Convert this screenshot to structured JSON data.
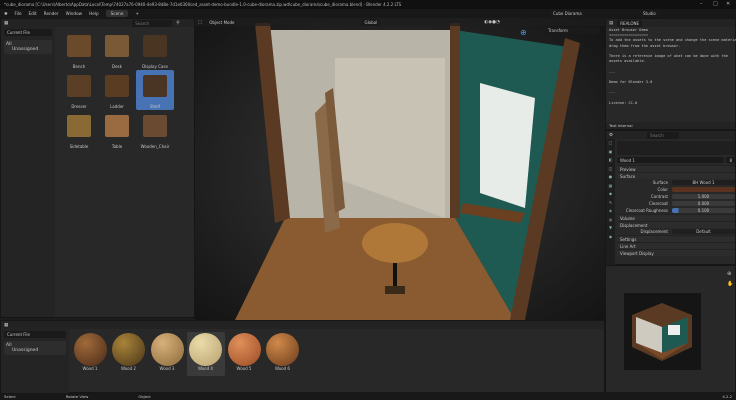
{
  "window": {
    "title": "*cube_diorama [C:\\Users\\Alberto\\AppData\\Local\\Temp\\74027a76-0940-4e93-8d8e-7d1e0300ced_asset-demo-bundle-1.0-cube-diorama.zip.wd\\cube_diorama\\cube_diorama.blend] - Blender 4.2.2 LTS"
  },
  "menu": {
    "items": [
      "File",
      "Edit",
      "Render",
      "Window",
      "Help"
    ],
    "workspace_tab": "Scene"
  },
  "topright": {
    "scene": "Cube Diorama",
    "view_layer": "Studio",
    "render_layer": "REALONE"
  },
  "asset_browser_top": {
    "library": "Current File",
    "search_placeholder": "Search",
    "catalog_all": "All",
    "catalog_unassigned": "Unassigned",
    "assets": [
      "Bench",
      "Desk",
      "Display Case",
      "Dresser",
      "Ladder",
      "Shelf",
      "Sidetable",
      "Table",
      "Wooden_Chair"
    ],
    "selected": "Shelf"
  },
  "viewport": {
    "mode": "Object Mode",
    "orientation": "Global",
    "transform_panel": "Transform"
  },
  "text_editor": {
    "lines": [
      "Asset Browser Demo",
      "==================",
      "To add the assets to the scene and change the scene materials",
      "drag them from the asset browser.",
      "",
      "There is a reference image of what can be done with the",
      "assets available.",
      "",
      "---",
      "",
      "Demo for Blender 3.0",
      "",
      "---",
      "",
      "License: CC-0"
    ],
    "footer": "Text Internal"
  },
  "properties": {
    "search_placeholder": "Search",
    "material": "Wood 1",
    "users": "8",
    "sections": {
      "preview": "Preview",
      "surface": "Surface",
      "volume": "Volume",
      "displacement": "Displacement",
      "settings": "Settings",
      "line_art": "Line Art",
      "viewport_display": "Viewport Display"
    },
    "surface_label": "Surface",
    "surface_value": "BH Wood 1",
    "color_label": "Color",
    "color_value": "#5a3320",
    "fields": [
      {
        "label": "Contrast",
        "value": "1.000"
      },
      {
        "label": "Clearcoat",
        "value": "0.000"
      },
      {
        "label": "Clearcoat Roughness",
        "value": "0.100",
        "fill": 0.1
      }
    ],
    "displacement_label": "Displacement",
    "displacement_value": "Default"
  },
  "asset_browser_bottom": {
    "library": "Current File",
    "catalog_all": "All",
    "catalog_unassigned": "Unassigned",
    "materials": [
      "Wood 1",
      "Wood 2",
      "Wood 3",
      "Wood 4",
      "Wood 5",
      "Wood 6"
    ],
    "selected": "Wood 4"
  },
  "status": {
    "select": "Select",
    "rotate": "Rotate View",
    "object": "Object",
    "version": "4.2.2"
  }
}
